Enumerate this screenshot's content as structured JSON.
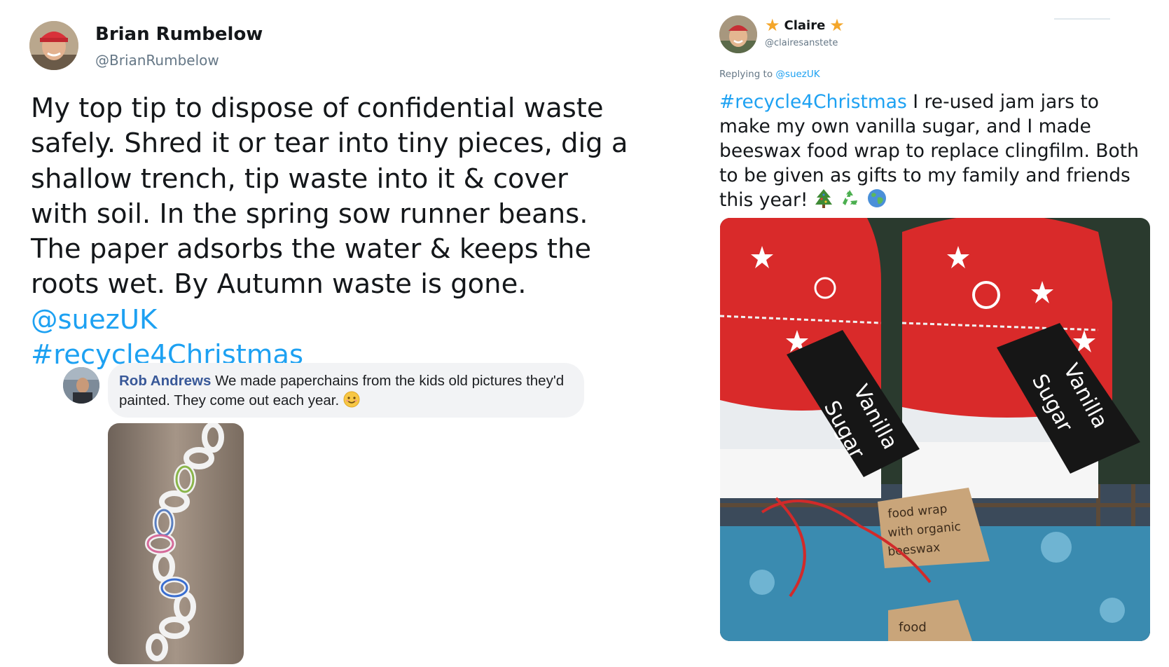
{
  "tweet_left": {
    "author_name": "Brian Rumbelow",
    "author_handle": "@BrianRumbelow",
    "text": "My top tip to dispose of confidential waste safely. Shred it or tear into tiny pieces, dig a shallow trench, tip waste into it & cover with soil. In the spring sow runner beans. The paper adsorbs the water & keeps the roots wet. By Autumn waste is gone. ",
    "mention": "@suezUK",
    "hashtag": "#recycle4Christmas"
  },
  "comment": {
    "author_name": "Rob Andrews",
    "text": "We made paperchains from the kids old pictures they'd painted. They come out each year.",
    "emoji": "smiling-face"
  },
  "tweet_right": {
    "author_name": "Claire",
    "author_handle": "@clairesanstete",
    "name_decoration": "star",
    "replying_label": "Replying to ",
    "replying_to": "@suezUK",
    "hashtag": "#recycle4Christmas",
    "text": " I re-used jam jars to make my own vanilla sugar, and I made beeswax food wrap to replace clingfilm. Both to be given as gifts to my family and friends this year!",
    "emojis": [
      "christmas-tree",
      "recycling-symbol",
      "globe"
    ],
    "photo_tags": [
      "Vanilla",
      "Sugar",
      "Vanilla",
      "Sugar",
      "food wrap",
      "with organic",
      "beeswax",
      "food"
    ]
  },
  "colors": {
    "link": "#1da1f2",
    "fb_name": "#385898",
    "star": "#f4a62a",
    "muted": "#657786"
  }
}
